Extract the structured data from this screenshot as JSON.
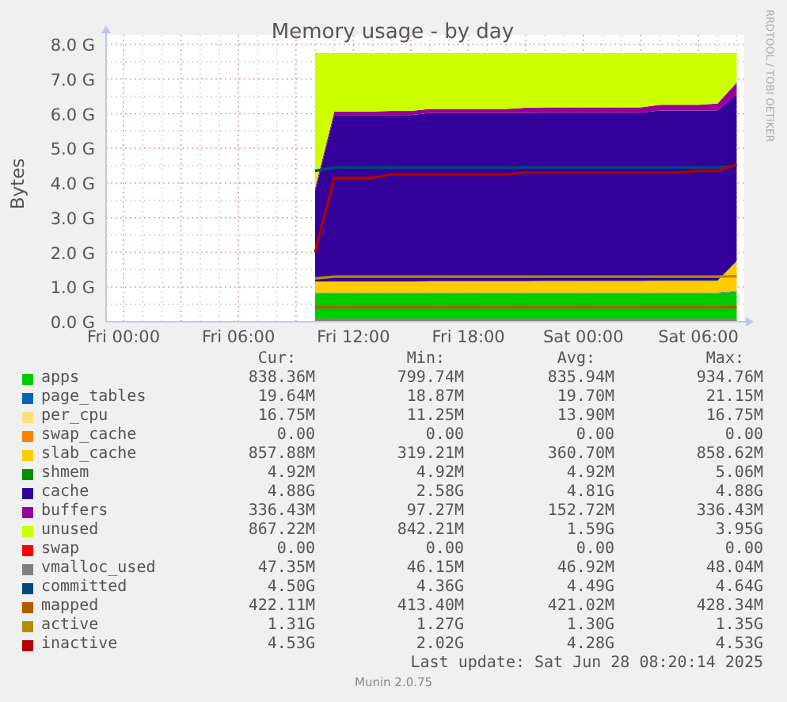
{
  "graph": {
    "side_credit": "RRDTOOL / TOBI OETIKER",
    "chart_data": {
      "type": "area",
      "title": "Memory usage - by day",
      "ylabel": "Bytes",
      "stacked": true,
      "categories": [
        "Fri 00:00",
        null,
        null,
        null,
        null,
        null,
        "Fri 06:00",
        null,
        null,
        null,
        null,
        null,
        "Fri 12:00",
        null,
        null,
        null,
        null,
        null,
        "Fri 18:00",
        null,
        null,
        null,
        null,
        null,
        "Sat 00:00",
        null,
        null,
        null,
        null,
        null,
        "Sat 06:00",
        null,
        null
      ],
      "ylim": [
        0,
        8
      ],
      "grid": true,
      "yticks": [
        {
          "value": 0,
          "label": "0.0 G"
        },
        {
          "value": 1,
          "label": "1.0 G"
        },
        {
          "value": 2,
          "label": "2.0 G"
        },
        {
          "value": 3,
          "label": "3.0 G"
        },
        {
          "value": 4,
          "label": "4.0 G"
        },
        {
          "value": 5,
          "label": "5.0 G"
        },
        {
          "value": 6,
          "label": "6.0 G"
        },
        {
          "value": 7,
          "label": "7.0 G"
        },
        {
          "value": 8,
          "label": "8.0 G"
        }
      ],
      "series": [
        {
          "name": "apps",
          "type": "area",
          "color": "#00cc00",
          "values": [
            null,
            null,
            null,
            null,
            null,
            null,
            null,
            null,
            null,
            null,
            0.81,
            0.81,
            0.81,
            0.81,
            0.81,
            0.81,
            0.81,
            0.81,
            0.81,
            0.81,
            0.81,
            0.81,
            0.81,
            0.81,
            0.81,
            0.81,
            0.81,
            0.81,
            0.81,
            0.81,
            0.81,
            0.81,
            0.86
          ]
        },
        {
          "name": "page_tables",
          "type": "area",
          "color": "#0066b3",
          "values": [
            null,
            null,
            null,
            null,
            null,
            null,
            null,
            null,
            null,
            null,
            0.02,
            0.02,
            0.02,
            0.02,
            0.02,
            0.02,
            0.02,
            0.02,
            0.02,
            0.02,
            0.02,
            0.02,
            0.02,
            0.02,
            0.02,
            0.02,
            0.02,
            0.02,
            0.02,
            0.02,
            0.02,
            0.02,
            0.02
          ]
        },
        {
          "name": "per_cpu",
          "type": "area",
          "color": "#ffe080",
          "values": [
            null,
            null,
            null,
            null,
            null,
            null,
            null,
            null,
            null,
            null,
            null,
            null,
            null,
            null,
            null,
            null,
            null,
            null,
            null,
            null,
            null,
            null,
            null,
            null,
            null,
            null,
            null,
            null,
            null,
            null,
            null,
            null,
            null
          ]
        },
        {
          "name": "swap_cache",
          "type": "area",
          "color": "#ff8000",
          "values": [
            null,
            null,
            null,
            null,
            null,
            null,
            null,
            null,
            null,
            null,
            null,
            null,
            null,
            null,
            null,
            null,
            null,
            null,
            null,
            null,
            null,
            null,
            null,
            null,
            null,
            null,
            null,
            null,
            null,
            null,
            null,
            null,
            null
          ]
        },
        {
          "name": "slab_cache",
          "type": "area",
          "color": "#ffcc00",
          "values": [
            null,
            null,
            null,
            null,
            null,
            null,
            null,
            null,
            null,
            null,
            0.32,
            0.32,
            0.32,
            0.32,
            0.32,
            0.32,
            0.33,
            0.33,
            0.33,
            0.33,
            0.33,
            0.33,
            0.34,
            0.34,
            0.34,
            0.34,
            0.34,
            0.34,
            0.35,
            0.35,
            0.35,
            0.35,
            0.86
          ]
        },
        {
          "name": "shmem",
          "type": "area",
          "color": "#008f00",
          "values": [
            null,
            null,
            null,
            null,
            null,
            null,
            null,
            null,
            null,
            null,
            0.01,
            0.01,
            0.01,
            0.01,
            0.01,
            0.01,
            0.01,
            0.01,
            0.01,
            0.01,
            0.01,
            0.01,
            0.01,
            0.01,
            0.01,
            0.01,
            0.01,
            0.01,
            0.01,
            0.01,
            0.01,
            0.01,
            0.01
          ]
        },
        {
          "name": "cache",
          "type": "area",
          "color": "#330099",
          "values": [
            null,
            null,
            null,
            null,
            null,
            null,
            null,
            null,
            null,
            null,
            2.6,
            4.8,
            4.8,
            4.8,
            4.8,
            4.8,
            4.85,
            4.85,
            4.85,
            4.85,
            4.85,
            4.85,
            4.85,
            4.85,
            4.85,
            4.85,
            4.85,
            4.85,
            4.9,
            4.9,
            4.9,
            4.9,
            4.81
          ]
        },
        {
          "name": "buffers",
          "type": "area",
          "color": "#990099",
          "values": [
            null,
            null,
            null,
            null,
            null,
            null,
            null,
            null,
            null,
            null,
            0.1,
            0.1,
            0.1,
            0.1,
            0.12,
            0.12,
            0.12,
            0.12,
            0.12,
            0.12,
            0.12,
            0.15,
            0.15,
            0.15,
            0.15,
            0.15,
            0.15,
            0.15,
            0.17,
            0.17,
            0.17,
            0.2,
            0.34
          ]
        },
        {
          "name": "unused",
          "type": "area",
          "color": "#ccff00",
          "values": [
            null,
            null,
            null,
            null,
            null,
            null,
            null,
            null,
            null,
            null,
            3.89,
            1.69,
            1.69,
            1.69,
            1.67,
            1.67,
            1.61,
            1.61,
            1.61,
            1.61,
            1.61,
            1.58,
            1.57,
            1.57,
            1.57,
            1.57,
            1.57,
            1.57,
            1.49,
            1.49,
            1.49,
            1.46,
            0.85
          ]
        },
        {
          "name": "swap",
          "type": "line",
          "color": "#ff0000",
          "values": [
            null,
            null,
            null,
            null,
            null,
            null,
            null,
            null,
            null,
            null,
            null,
            null,
            null,
            null,
            null,
            null,
            null,
            null,
            null,
            null,
            null,
            null,
            null,
            null,
            null,
            null,
            null,
            null,
            null,
            null,
            null,
            null,
            null
          ]
        },
        {
          "name": "vmalloc_used",
          "type": "line",
          "color": "#808080",
          "values": [
            null,
            null,
            null,
            null,
            null,
            null,
            null,
            null,
            null,
            null,
            0.05,
            0.05,
            0.05,
            0.05,
            0.05,
            0.05,
            0.05,
            0.05,
            0.05,
            0.05,
            0.05,
            0.05,
            0.05,
            0.05,
            0.05,
            0.05,
            0.05,
            0.05,
            0.05,
            0.05,
            0.05,
            0.05,
            0.05
          ]
        },
        {
          "name": "committed",
          "type": "line",
          "color": "#00487d",
          "values": [
            null,
            null,
            null,
            null,
            null,
            null,
            null,
            null,
            null,
            null,
            4.35,
            4.45,
            4.45,
            4.45,
            4.45,
            4.45,
            4.45,
            4.45,
            4.45,
            4.45,
            4.45,
            4.45,
            4.45,
            4.45,
            4.45,
            4.45,
            4.45,
            4.45,
            4.45,
            4.45,
            4.45,
            4.45,
            4.5
          ]
        },
        {
          "name": "mapped",
          "type": "line",
          "color": "#b35a00",
          "values": [
            null,
            null,
            null,
            null,
            null,
            null,
            null,
            null,
            null,
            null,
            0.42,
            0.42,
            0.42,
            0.42,
            0.42,
            0.42,
            0.42,
            0.42,
            0.42,
            0.42,
            0.42,
            0.42,
            0.42,
            0.42,
            0.42,
            0.42,
            0.42,
            0.42,
            0.42,
            0.42,
            0.42,
            0.42,
            0.42
          ]
        },
        {
          "name": "active",
          "type": "line",
          "color": "#b38f00",
          "values": [
            null,
            null,
            null,
            null,
            null,
            null,
            null,
            null,
            null,
            null,
            1.25,
            1.3,
            1.3,
            1.3,
            1.3,
            1.3,
            1.3,
            1.3,
            1.3,
            1.3,
            1.3,
            1.3,
            1.3,
            1.3,
            1.3,
            1.3,
            1.3,
            1.3,
            1.3,
            1.3,
            1.3,
            1.3,
            1.31
          ]
        },
        {
          "name": "inactive",
          "type": "line",
          "color": "#b30000",
          "values": [
            null,
            null,
            null,
            null,
            null,
            null,
            null,
            null,
            null,
            null,
            2.0,
            4.15,
            4.15,
            4.15,
            4.25,
            4.25,
            4.25,
            4.25,
            4.25,
            4.25,
            4.25,
            4.3,
            4.3,
            4.3,
            4.3,
            4.3,
            4.3,
            4.3,
            4.3,
            4.3,
            4.35,
            4.35,
            4.53
          ]
        }
      ]
    }
  },
  "legend": {
    "columns": [
      "Cur:",
      "Min:",
      "Avg:",
      "Max:"
    ],
    "rows": [
      {
        "cur": "838.36M",
        "min": "799.74M",
        "avg": "835.94M",
        "max": "934.76M"
      },
      {
        "cur": "19.64M",
        "min": "18.87M",
        "avg": "19.70M",
        "max": "21.15M"
      },
      {
        "cur": "16.75M",
        "min": "11.25M",
        "avg": "13.90M",
        "max": "16.75M"
      },
      {
        "cur": "0.00",
        "min": "0.00",
        "avg": "0.00",
        "max": "0.00"
      },
      {
        "cur": "857.88M",
        "min": "319.21M",
        "avg": "360.70M",
        "max": "858.62M"
      },
      {
        "cur": "4.92M",
        "min": "4.92M",
        "avg": "4.92M",
        "max": "5.06M"
      },
      {
        "cur": "4.88G",
        "min": "2.58G",
        "avg": "4.81G",
        "max": "4.88G"
      },
      {
        "cur": "336.43M",
        "min": "97.27M",
        "avg": "152.72M",
        "max": "336.43M"
      },
      {
        "cur": "867.22M",
        "min": "842.21M",
        "avg": "1.59G",
        "max": "3.95G"
      },
      {
        "cur": "0.00",
        "min": "0.00",
        "avg": "0.00",
        "max": "0.00"
      },
      {
        "cur": "47.35M",
        "min": "46.15M",
        "avg": "46.92M",
        "max": "48.04M"
      },
      {
        "cur": "4.50G",
        "min": "4.36G",
        "avg": "4.49G",
        "max": "4.64G"
      },
      {
        "cur": "422.11M",
        "min": "413.40M",
        "avg": "421.02M",
        "max": "428.34M"
      },
      {
        "cur": "1.31G",
        "min": "1.27G",
        "avg": "1.30G",
        "max": "1.35G"
      },
      {
        "cur": "4.53G",
        "min": "2.02G",
        "avg": "4.28G",
        "max": "4.53G"
      }
    ]
  },
  "last_update": "Last update: Sat Jun 28 08:20:14 2025",
  "footer": "Munin 2.0.75"
}
